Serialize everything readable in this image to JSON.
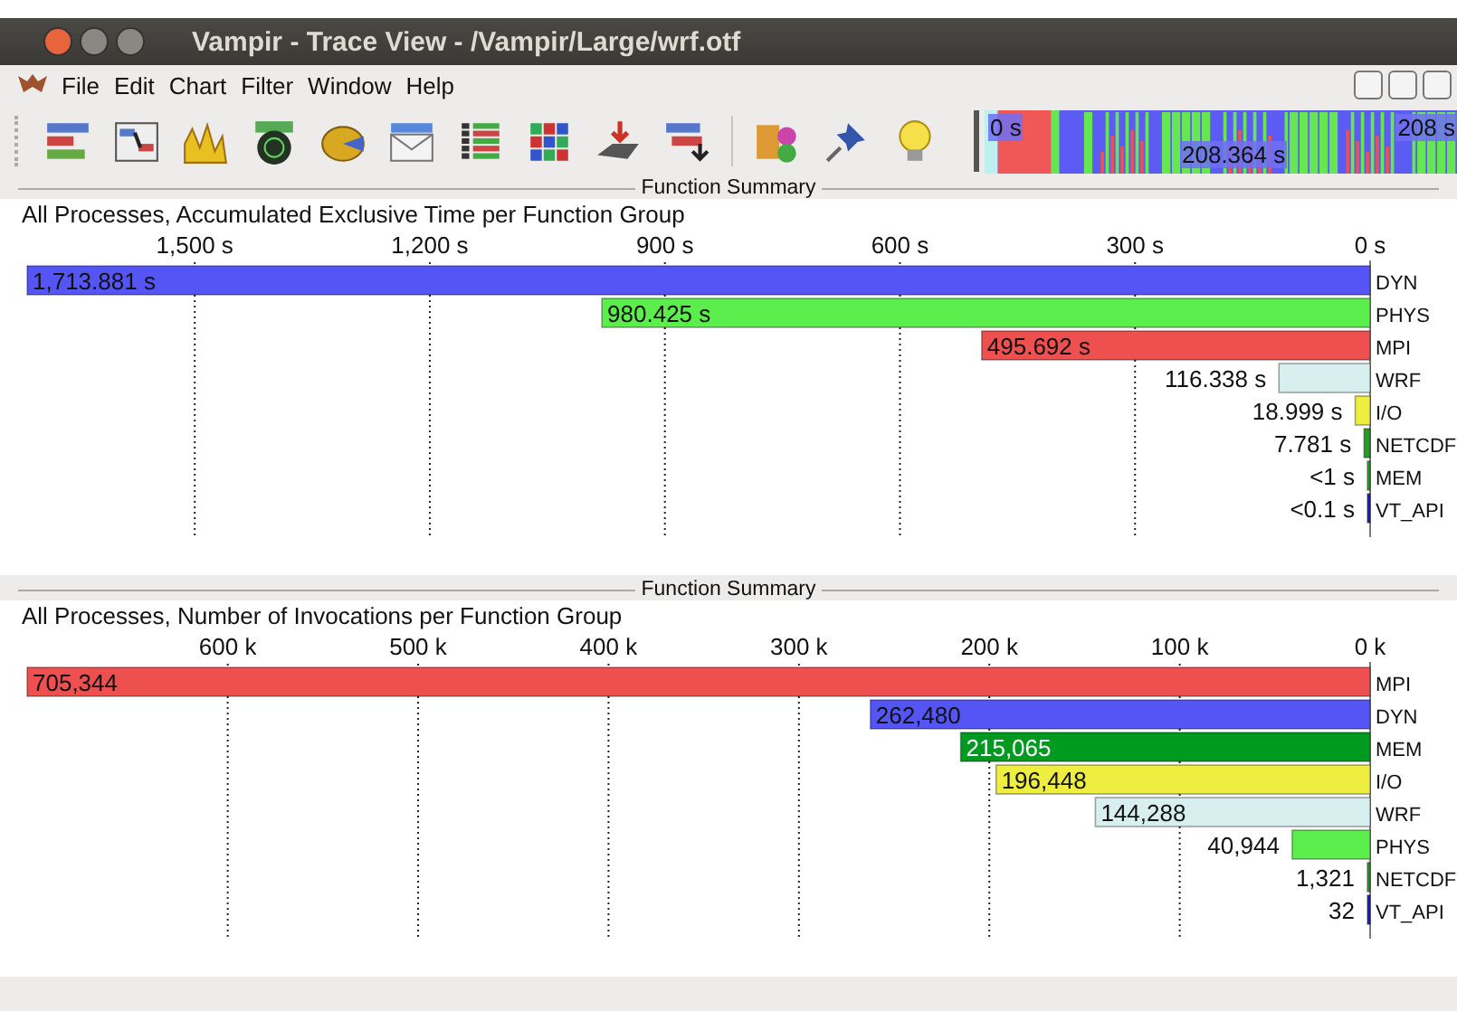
{
  "window": {
    "title": "Vampir - Trace View - /Vampir/Large/wrf.otf"
  },
  "menu": [
    "File",
    "Edit",
    "Chart",
    "Filter",
    "Window",
    "Help"
  ],
  "overview": {
    "start": "0 s",
    "middle": "208.364 s",
    "end": "208 s"
  },
  "panels": [
    {
      "header": "Function Summary",
      "title": "All Processes, Accumulated Exclusive Time per Function Group",
      "chart_data": {
        "type": "bar",
        "orientation": "horizontal",
        "categories": [
          "DYN",
          "PHYS",
          "MPI",
          "WRF",
          "I/O",
          "NETCDF",
          "MEM",
          "VT_API"
        ],
        "values": [
          1713.881,
          980.425,
          495.692,
          116.338,
          18.999,
          7.781,
          0.5,
          0.05
        ],
        "colors": [
          "#5555f5",
          "#5cee4c",
          "#ee5050",
          "#d8eff0",
          "#eeee40",
          "#2a9a2a",
          "#22aa22",
          "#2222cc"
        ],
        "value_labels": [
          "1,713.881 s",
          "980.425 s",
          "495.692 s",
          "116.338 s",
          "18.999 s",
          "7.781 s",
          "<1 s",
          "<0.1 s"
        ],
        "grid": true,
        "xlim": [
          1713.881,
          0
        ],
        "xticks": [
          {
            "value": 1500,
            "label": "1,500 s"
          },
          {
            "value": 1200,
            "label": "1,200 s"
          },
          {
            "value": 900,
            "label": "900 s"
          },
          {
            "value": 600,
            "label": "600 s"
          },
          {
            "value": 300,
            "label": "300 s"
          },
          {
            "value": 0,
            "label": "0 s"
          }
        ]
      }
    },
    {
      "header": "Function Summary",
      "title": "All Processes, Number of Invocations per Function Group",
      "chart_data": {
        "type": "bar",
        "orientation": "horizontal",
        "categories": [
          "MPI",
          "DYN",
          "MEM",
          "I/O",
          "WRF",
          "PHYS",
          "NETCDF",
          "VT_API"
        ],
        "values": [
          705344,
          262480,
          215065,
          196448,
          144288,
          40944,
          1321,
          32
        ],
        "colors": [
          "#ee5050",
          "#5555f5",
          "#009a20",
          "#eeee40",
          "#d8eff0",
          "#5cee4c",
          "#2a9a2a",
          "#2222cc"
        ],
        "value_labels": [
          "705,344",
          "262,480",
          "215,065",
          "196,448",
          "144,288",
          "40,944",
          "1,321",
          "32"
        ],
        "grid": true,
        "xlim": [
          705344,
          0
        ],
        "xticks": [
          {
            "value": 600000,
            "label": "600 k"
          },
          {
            "value": 500000,
            "label": "500 k"
          },
          {
            "value": 400000,
            "label": "400 k"
          },
          {
            "value": 300000,
            "label": "300 k"
          },
          {
            "value": 200000,
            "label": "200 k"
          },
          {
            "value": 100000,
            "label": "100 k"
          },
          {
            "value": 0,
            "label": "0 k"
          }
        ]
      }
    }
  ]
}
